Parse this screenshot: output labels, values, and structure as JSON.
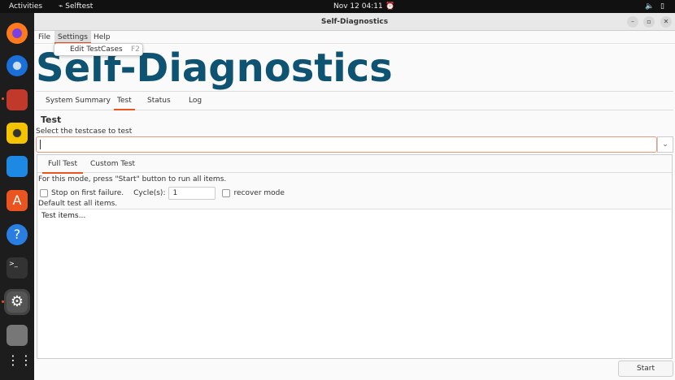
{
  "topbar": {
    "activities": "Activities",
    "app": "Selftest",
    "datetime": "Nov 12  04:11"
  },
  "window": {
    "title": "Self-Diagnostics"
  },
  "menu": {
    "file": "File",
    "settings": "Settings",
    "help": "Help",
    "dropdown": {
      "item": "Edit TestCases",
      "shortcut": "F2"
    }
  },
  "banner": "Self-Diagnostics",
  "tabs": [
    "System Summary",
    "Test",
    "Status",
    "Log"
  ],
  "test": {
    "heading": "Test",
    "select_label": "Select the testcase to test",
    "select_value": "",
    "subtabs": [
      "Full Test",
      "Custom Test"
    ],
    "info": "For this mode, press \"Start\" button to run all items.",
    "stop_label": "Stop on first failure.",
    "cycles_label": "Cycle(s):",
    "cycles_value": "1",
    "recover_label": "recover mode",
    "default_text": "Default test all items.",
    "list_header": "Test items...",
    "start": "Start"
  }
}
